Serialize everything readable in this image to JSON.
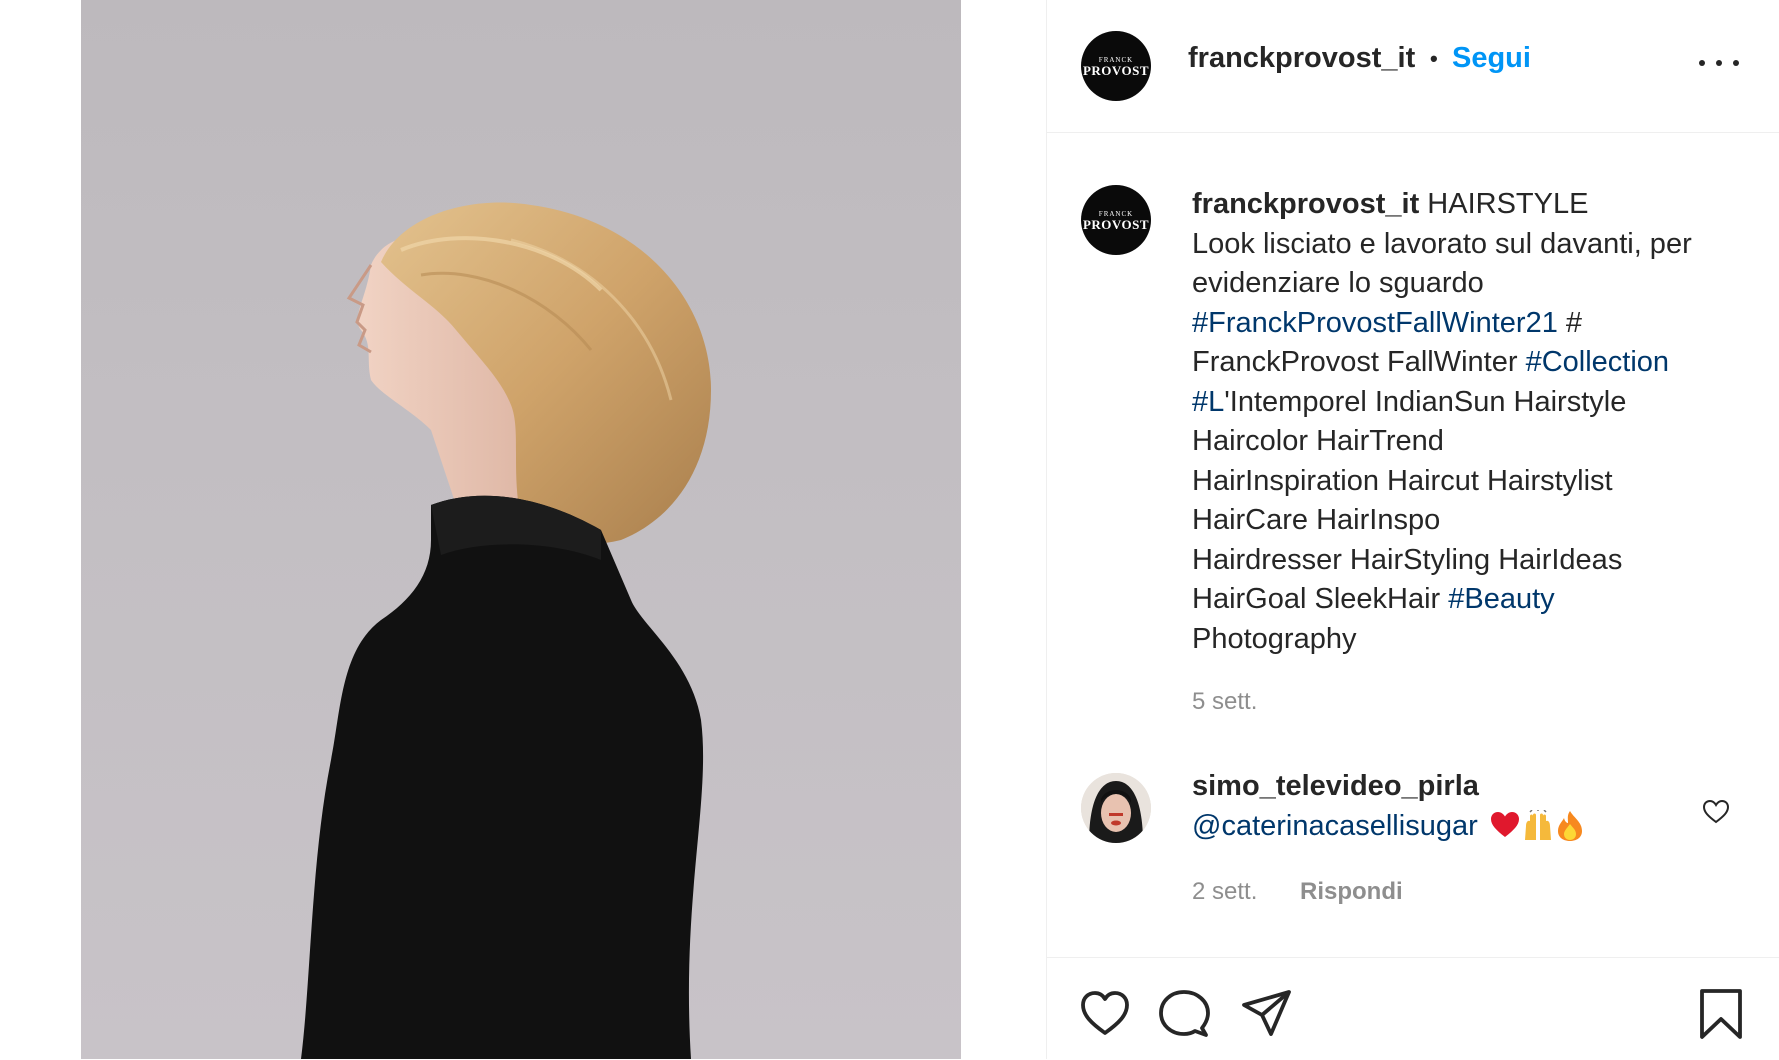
{
  "post": {
    "image_alt": "Profilo di donna con caschetto biondo e dolcevita nero"
  },
  "header": {
    "avatar_logo_top": "FRANCK",
    "avatar_logo_bottom": "PROVOST",
    "username": "franckprovost_it",
    "separator": "•",
    "follow_label": "Segui",
    "more_icon": "more-horizontal-icon"
  },
  "caption": {
    "username": "franckprovost_it",
    "line1_rest": " HAIRSTYLE",
    "line2": "Look lisciato e lavorato sul davanti, per evidenziare lo sguardo",
    "tag1": "#FranckProvostFallWinter21",
    "after_tag1": " #",
    "line4": "FranckProvost FallWinter ",
    "tag2": "#Collection",
    "tag3": "#L",
    "after_tag3": "'Intemporel IndianSun Hairstyle",
    "line6": "Haircolor HairTrend",
    "line7": "HairInspiration Haircut Hairstylist",
    "line8": "HairCare HairInspo",
    "line9": "Hairdresser HairStyling HairIdeas",
    "line10": "HairGoal SleekHair ",
    "tag4": "#Beauty",
    "line11": "Photography",
    "time": "5 sett."
  },
  "comment": {
    "username": "simo_televideo_pirla",
    "mention": "@caterinacasellisugar",
    "emojis": [
      "red-heart",
      "raising-hands",
      "fire"
    ],
    "time": "2 sett.",
    "reply_label": "Rispondi"
  },
  "actions": {
    "like_icon": "heart-icon",
    "comment_icon": "comment-icon",
    "share_icon": "share-icon",
    "save_icon": "bookmark-icon"
  }
}
